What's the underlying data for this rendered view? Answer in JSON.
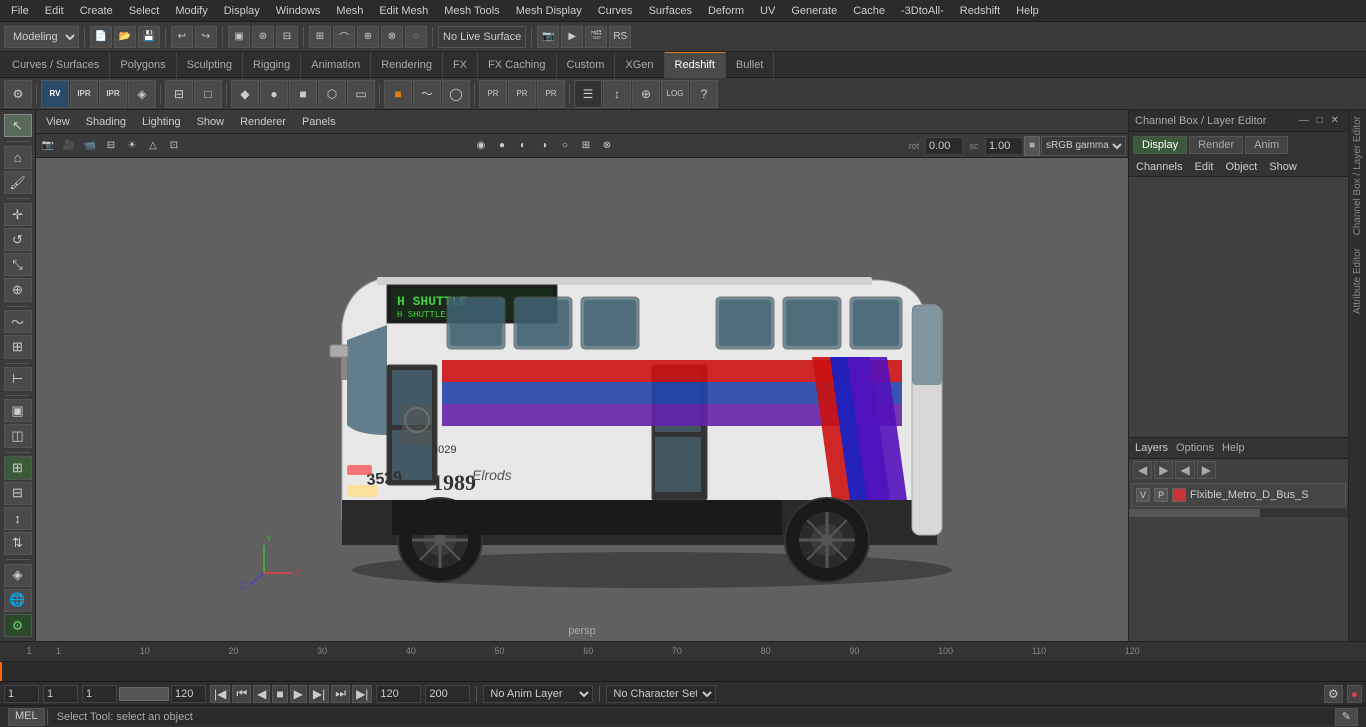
{
  "menu": {
    "items": [
      "File",
      "Edit",
      "Create",
      "Select",
      "Modify",
      "Display",
      "Windows",
      "Mesh",
      "Edit Mesh",
      "Mesh Tools",
      "Mesh Display",
      "Curves",
      "Surfaces",
      "Deform",
      "UV",
      "Generate",
      "Cache",
      "-3DtoAll-",
      "Redshift",
      "Help"
    ]
  },
  "toolbar1": {
    "workspace_label": "Modeling",
    "no_live_label": "No Live Surface"
  },
  "workspace_tabs": {
    "tabs": [
      "Curves / Surfaces",
      "Polygons",
      "Sculpting",
      "Rigging",
      "Animation",
      "Rendering",
      "FX",
      "FX Caching",
      "Custom",
      "XGen",
      "Redshift",
      "Bullet"
    ]
  },
  "viewport": {
    "menus": [
      "View",
      "Shading",
      "Lighting",
      "Show",
      "Renderer",
      "Panels"
    ],
    "persp_label": "persp",
    "rotate_value": "0.00",
    "scale_value": "1.00",
    "gamma_label": "sRGB gamma"
  },
  "right_panel": {
    "title": "Channel Box / Layer Editor",
    "tabs": {
      "display": "Display",
      "render": "Render",
      "anim": "Anim"
    },
    "active_tab": "Display",
    "channel_menus": [
      "Channels",
      "Edit",
      "Object",
      "Show"
    ],
    "layers_label": "Layers",
    "options_label": "Options",
    "help_label": "Help",
    "layer": {
      "v_label": "V",
      "p_label": "P",
      "name": "Flxible_Metro_D_Bus_S"
    }
  },
  "timeline": {
    "start": "1",
    "end": "120",
    "ticks": [
      "1",
      "10",
      "20",
      "30",
      "40",
      "50",
      "60",
      "70",
      "80",
      "90",
      "100",
      "110",
      "120"
    ],
    "playhead_pos": 0
  },
  "bottom_bar": {
    "frame_start": "1",
    "frame_current": "1",
    "frame_step": "1",
    "anim_end": "120",
    "range_end": "120",
    "max_range": "200",
    "no_anim_layer": "No Anim Layer",
    "no_char_set": "No Character Set"
  },
  "status_bar": {
    "text": "Select Tool: select an object",
    "mel_label": "MEL"
  },
  "icons": {
    "undo": "↩",
    "redo": "↪",
    "save": "💾",
    "open": "📁",
    "new": "📄",
    "snap_grid": "⊞",
    "snap_curve": "⌒",
    "snap_point": "⊕",
    "move": "✛",
    "rotate": "↺",
    "scale": "⤡",
    "select": "↖",
    "play_start": "⏮",
    "play_prev_key": "⏪",
    "play_prev": "◀",
    "play_stop": "⏹",
    "play_fwd": "▶",
    "play_next": "⏩",
    "play_next_key": "⏭",
    "play_end": "⏭"
  }
}
